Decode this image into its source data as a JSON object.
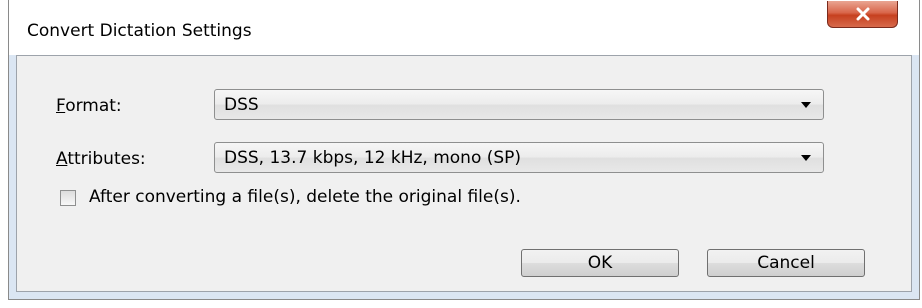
{
  "window": {
    "title": "Convert Dictation Settings",
    "close_icon": "close-icon"
  },
  "form": {
    "format": {
      "label_mnemonic": "F",
      "label_rest": "ormat:",
      "value": "DSS"
    },
    "attributes": {
      "label_mnemonic": "A",
      "label_rest": "ttributes:",
      "value": "DSS, 13.7 kbps, 12 kHz, mono (SP)"
    },
    "delete_original": {
      "label": "After converting a file(s), delete the original file(s).",
      "checked": false
    }
  },
  "buttons": {
    "ok": "OK",
    "cancel": "Cancel"
  },
  "colors": {
    "close_button": "#c6401f",
    "client_background": "#f0f0f0",
    "frame_background": "#dbe6f3"
  }
}
